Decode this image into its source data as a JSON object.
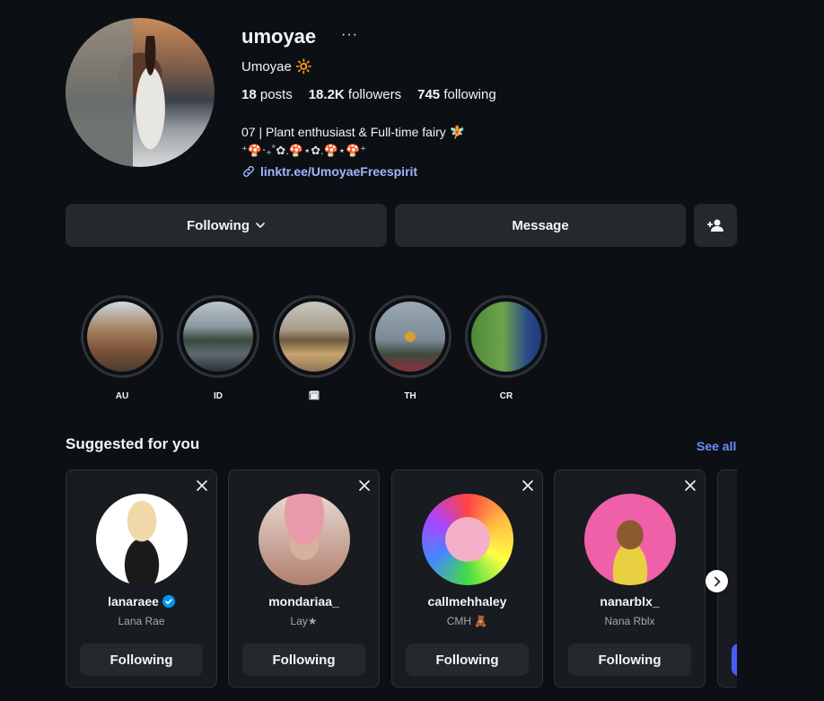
{
  "profile": {
    "username": "umoyae",
    "more_icon": "···",
    "full_name": "Umoyae 🔆",
    "posts_count": "18",
    "posts_label": "posts",
    "followers_count": "18.2K",
    "followers_label": "followers",
    "following_count": "745",
    "following_label": "following",
    "bio_line1": "07 | Plant enthusiast & Full-time fairy 🧚",
    "bio_line2": "⁺🍄‧₊˚✿.🍄⋆✿.🍄⋆🍄⁺",
    "link": "linktr.ee/UmoyaeFreespirit"
  },
  "actions": {
    "following_label": "Following",
    "message_label": "Message"
  },
  "highlights": [
    {
      "label": "AU"
    },
    {
      "label": "ID"
    },
    {
      "label": "🗓"
    },
    {
      "label": "TH"
    },
    {
      "label": "CR"
    }
  ],
  "suggested": {
    "title": "Suggested for you",
    "see_all": "See all",
    "cards": [
      {
        "username": "lanaraee",
        "subtitle": "Lana Rae",
        "verified": true,
        "button": "Following"
      },
      {
        "username": "mondariaa_",
        "subtitle": "Lay★",
        "verified": false,
        "button": "Following"
      },
      {
        "username": "callmehhaley",
        "subtitle": "CMH 🧸",
        "verified": false,
        "button": "Following"
      },
      {
        "username": "nanarblx_",
        "subtitle": "Nana Rblx",
        "verified": false,
        "button": "Following"
      }
    ]
  },
  "colors": {
    "background": "#0c1014",
    "button": "#25292e",
    "link": "#a3b4ff",
    "accent": "#6d8cff",
    "verified": "#0095f6"
  }
}
